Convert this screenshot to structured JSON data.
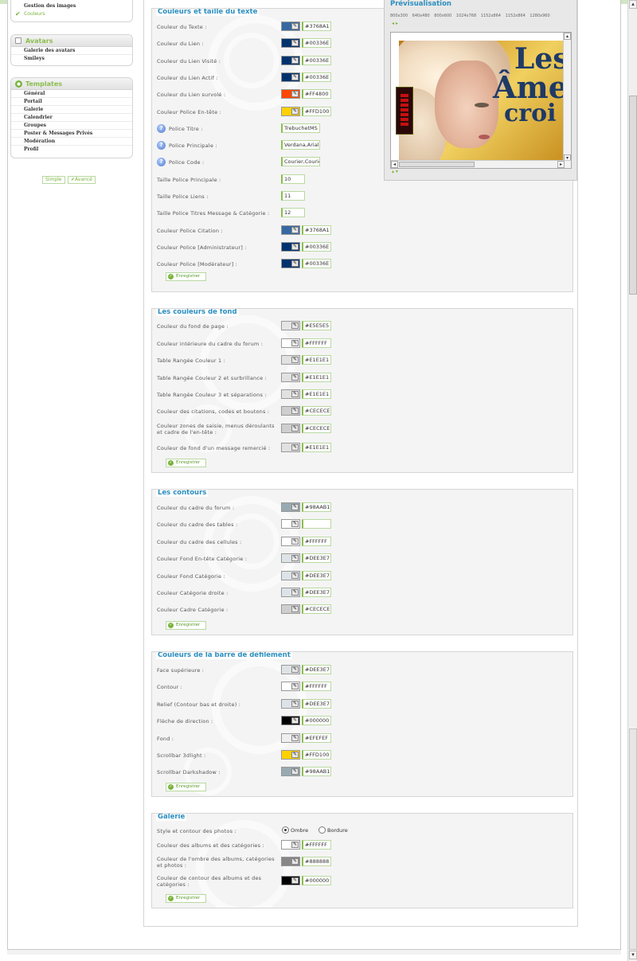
{
  "sidebar": {
    "top_items": [
      {
        "label": "Gestion des images"
      },
      {
        "label": "Couleurs",
        "active": true
      }
    ],
    "avatars": {
      "title": "Avatars",
      "items": [
        "Galerie des avatars",
        "Smileys"
      ]
    },
    "templates": {
      "title": "Templates",
      "items": [
        "Général",
        "Portail",
        "Galerie",
        "Calendrier",
        "Groupes",
        "Poster & Messages Privés",
        "Modération",
        "Profil"
      ]
    },
    "mode_buttons": {
      "simple": "Simple",
      "advanced": "Avancé"
    }
  },
  "preview": {
    "title": "Prévisualisation",
    "resolutions": [
      "800x300",
      "640x480",
      "800x600",
      "1024x768",
      "1152x864",
      "1152x864",
      "1280x960"
    ],
    "image_text": [
      "Les",
      "Âmes",
      "croi"
    ]
  },
  "save_label": "Enregistrer",
  "text_colors": {
    "title": "Couleurs et taille du texte",
    "rows": [
      {
        "label": "Couleur du Texte  :",
        "color": "#3768A1",
        "value": "#3768A1"
      },
      {
        "label": "Couleur du Lien  :",
        "color": "#00336E",
        "value": "#00336E"
      },
      {
        "label": "Couleur du Lien Visité  :",
        "color": "#00336E",
        "value": "#00336E"
      },
      {
        "label": "Couleur du Lien Actif  :",
        "color": "#00336E",
        "value": "#00336E"
      },
      {
        "label": "Couleur du Lien survolé  :",
        "color": "#FF4800",
        "value": "#FF4800"
      },
      {
        "label": "Couleur Police En-tête  :",
        "color": "#FFD100",
        "value": "#FFD100"
      }
    ],
    "fonts": [
      {
        "label": "Police Titre  :",
        "value": "TrebuchetMS"
      },
      {
        "label": "Police Principale  :",
        "value": "Verdana,Arial"
      },
      {
        "label": "Police Code  :",
        "value": "Courier,Courier New"
      }
    ],
    "sizes": [
      {
        "label": "Taille Police Principale  :",
        "value": "10"
      },
      {
        "label": "Taille Police Liens  :",
        "value": "11"
      },
      {
        "label": "Taille Police Titres Message & Catégorie  :",
        "value": "12"
      }
    ],
    "rows2": [
      {
        "label": "Couleur Police Citation  :",
        "color": "#3768A1",
        "value": "#3768A1"
      },
      {
        "label": "Couleur Police [Administrateur]  :",
        "color": "#00336E",
        "value": "#00336E"
      },
      {
        "label": "Couleur Police [Modérateur]  :",
        "color": "#00336E",
        "value": "#00336E"
      }
    ]
  },
  "background_colors": {
    "title": "Les couleurs de fond",
    "rows": [
      {
        "label": "Couleur du fond de page  :",
        "color": "#E5E5E5",
        "value": "#E5E5E5"
      },
      {
        "label": "Couleur intérieure du cadre du forum  :",
        "color": "#FFFFFF",
        "value": "#FFFFFF"
      },
      {
        "label": "Table Rangée Couleur 1  :",
        "color": "#E1E1E1",
        "value": "#E1E1E1"
      },
      {
        "label": "Table Rangée Couleur 2 et surbrillance  :",
        "color": "#E1E1E1",
        "value": "#E1E1E1"
      },
      {
        "label": "Table Rangée Couleur 3 et séparations  :",
        "color": "#E1E1E1",
        "value": "#E1E1E1"
      },
      {
        "label": "Couleur des citations, codes et boutons  :",
        "color": "#CECECE",
        "value": "#CECECE"
      },
      {
        "label": "Couleur zones de saisie, menus déroulants et cadre de l'en-tête  :",
        "color": "#CECECE",
        "value": "#CECECE"
      },
      {
        "label": "Couleur de fond d'un message remercié  :",
        "color": "#E1E1E1",
        "value": "#E1E1E1"
      }
    ]
  },
  "borders": {
    "title": "Les contours",
    "rows": [
      {
        "label": "Couleur du cadre du forum  :",
        "color": "#98AAB1",
        "value": "#98AAB1"
      },
      {
        "label": "Couleur du cadre des tables  :",
        "color": "#FFFFFF",
        "value": ""
      },
      {
        "label": "Couleur du cadre des cellules  :",
        "color": "#FFFFFF",
        "value": "#FFFFFF"
      },
      {
        "label": "Couleur Fond En-tête Catégorie  :",
        "color": "#DEE3E7",
        "value": "#DEE3E7"
      },
      {
        "label": "Couleur Fond Catégorie  :",
        "color": "#DEE3E7",
        "value": "#DEE3E7"
      },
      {
        "label": "Couleur Catégorie droite  :",
        "color": "#DEE3E7",
        "value": "#DEE3E7"
      },
      {
        "label": "Couleur Cadre Catégorie  :",
        "color": "#CECECE",
        "value": "#CECECE"
      }
    ]
  },
  "scrollbar_colors": {
    "title": "Couleurs de la barre de défilement",
    "rows": [
      {
        "label": "Face supérieure  :",
        "color": "#DEE3E7",
        "value": "#DEE3E7"
      },
      {
        "label": "Contour  :",
        "color": "#FFFFFF",
        "value": "#FFFFFF"
      },
      {
        "label": "Relief (Contour bas et droite)  :",
        "color": "#DEE3E7",
        "value": "#DEE3E7"
      },
      {
        "label": "Flèche de direction  :",
        "color": "#000000",
        "value": "#000000"
      },
      {
        "label": "Fond  :",
        "color": "#EFEFEF",
        "value": "#EFEFEF"
      },
      {
        "label": "Scrollbar 3dlight  :",
        "color": "#FFD100",
        "value": "#FFD100"
      },
      {
        "label": "Scrollbar Darkshadow  :",
        "color": "#98AAB1",
        "value": "#98AAB1"
      }
    ]
  },
  "gallery": {
    "title": "Galerie",
    "style_label": "Style et contour des photos  :",
    "style_options": [
      "Ombre",
      "Bordure"
    ],
    "style_selected": "Ombre",
    "rows": [
      {
        "label": "Couleur des albums et des catégories  :",
        "color": "#FFFFFF",
        "value": "#FFFFFF"
      },
      {
        "label": "Couleur de l'ombre des albums, catégories et photos  :",
        "color": "#888888",
        "value": "#888888"
      },
      {
        "label": "Couleur de contour des albums et des catégories  :",
        "color": "#000000",
        "value": "#000000"
      }
    ]
  }
}
